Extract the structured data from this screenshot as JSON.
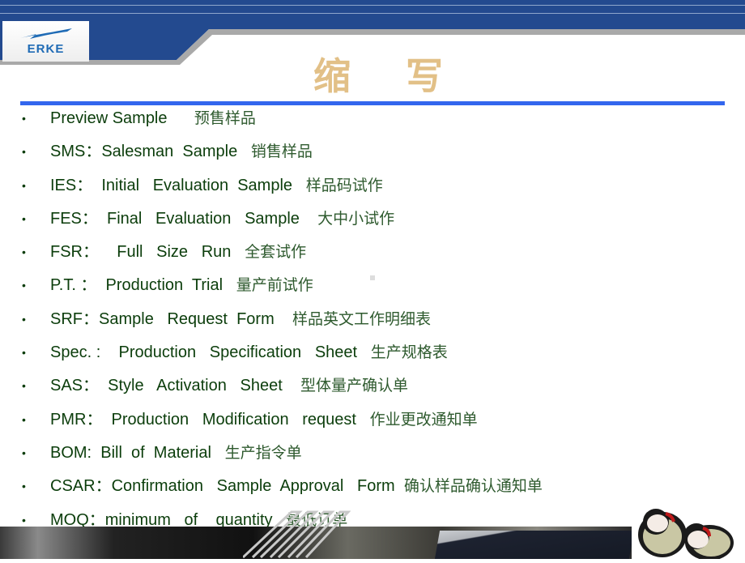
{
  "brand": {
    "logo_text": "ERKE",
    "colors": {
      "header_blue": "#234a8f",
      "title_gold": "#e2c087",
      "rule_blue": "#3366ee",
      "text_green": "#0b3d0b"
    }
  },
  "slide": {
    "title": "缩 写",
    "bullet_glyph": "•",
    "items": [
      {
        "en": "Preview Sample      ",
        "zh": "预售样品"
      },
      {
        "en": "SMS：Salesman  Sample   ",
        "zh": "销售样品"
      },
      {
        "en": "IES：  Initial   Evaluation  Sample   ",
        "zh": "样品码试作"
      },
      {
        "en": "FES：  Final   Evaluation   Sample    ",
        "zh": "大中小试作"
      },
      {
        "en": "FSR：    Full   Size   Run   ",
        "zh": "全套试作"
      },
      {
        "en": "P.T. ：  Production  Trial   ",
        "zh": "量产前试作"
      },
      {
        "en": "SRF：Sample   Request  Form    ",
        "zh": "样品英文工作明细表"
      },
      {
        "en": "Spec. :    Production   Specification   Sheet   ",
        "zh": "生产规格表"
      },
      {
        "en": "SAS：  Style   Activation   Sheet    ",
        "zh": "型体量产确认单"
      },
      {
        "en": "PMR：  Production   Modification   request   ",
        "zh": "作业更改通知单"
      },
      {
        "en": "BOM:  Bill  of  Material   ",
        "zh": "生产指令单"
      },
      {
        "en": "CSAR：Confirmation   Sample  Approval   Form  ",
        "zh": "确认样品确认通知单"
      },
      {
        "en": "MOQ：minimum   of    quantity   ",
        "zh": "最低订单"
      }
    ]
  },
  "images": {
    "bottom_banner": "monitor-photo-banner",
    "corner_image": "doll-slippers-photo"
  }
}
